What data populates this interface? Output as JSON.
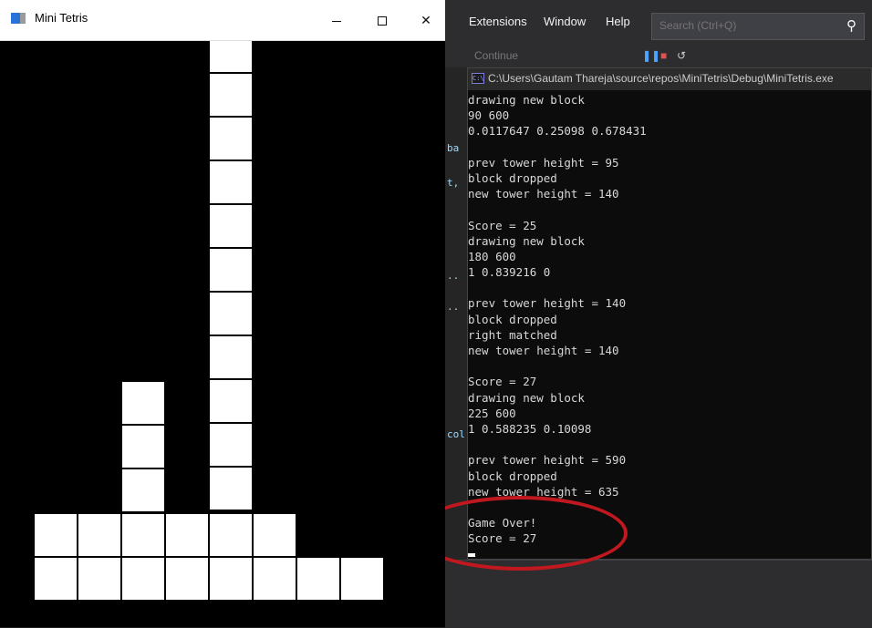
{
  "tetris_window": {
    "title": "Mini Tetris",
    "controls": {
      "minimize": "minimize-icon",
      "maximize": "maximize-icon",
      "close": "close-icon"
    },
    "block_color": "#ffffff",
    "background_color": "#000000"
  },
  "vs_window": {
    "menu": [
      "Extensions",
      "Window",
      "Help"
    ],
    "search_placeholder": "Search (Ctrl+Q)",
    "toolbar_continue": "Continue"
  },
  "console": {
    "title": "C:\\Users\\Gautam Thareja\\source\\repos\\MiniTetris\\Debug\\MiniTetris.exe",
    "lines": [
      "drawing new block",
      "90 600",
      "0.0117647 0.25098 0.678431",
      "",
      "prev tower height = 95",
      "block dropped",
      "new tower height = 140",
      "",
      "Score = 25",
      "drawing new block",
      "180 600",
      "1 0.839216 0",
      "",
      "prev tower height = 140",
      "block dropped",
      "right matched",
      "new tower height = 140",
      "",
      "Score = 27",
      "drawing new block",
      "225 600",
      "1 0.588235 0.10098",
      "",
      "prev tower height = 590",
      "block dropped",
      "new tower height = 635",
      "",
      "Game Over!",
      "Score = 27"
    ]
  },
  "annotation_color": "#c0181e"
}
